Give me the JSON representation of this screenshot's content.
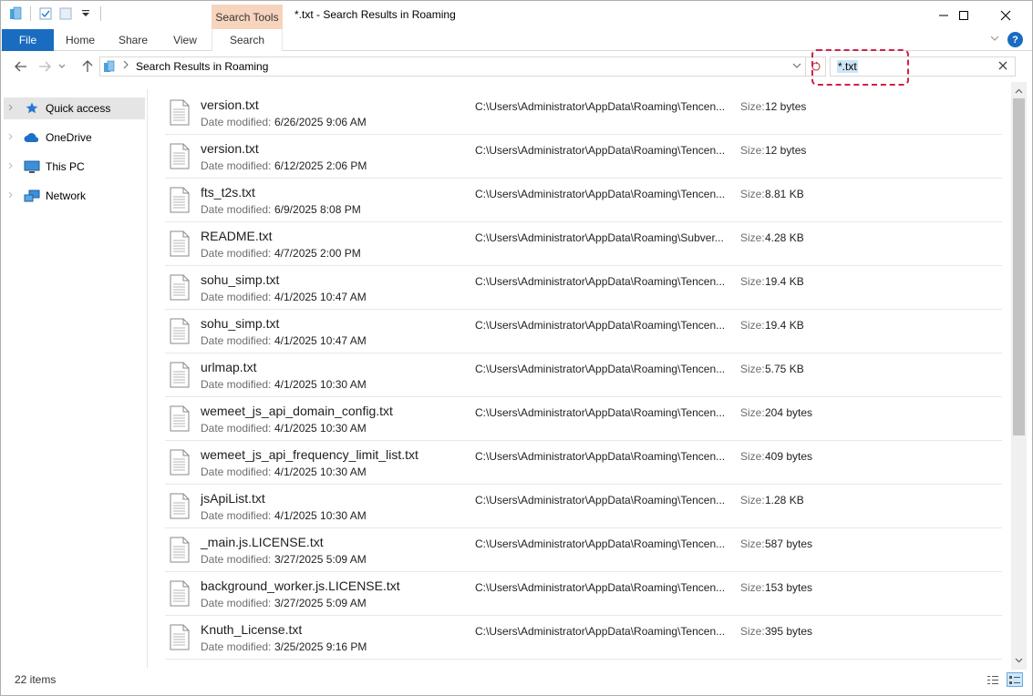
{
  "window": {
    "title": "*.txt - Search Results in Roaming",
    "context_tab": "Search Tools",
    "minimize": "—",
    "maximize": "☐",
    "close": "✕"
  },
  "ribbon": {
    "tabs": [
      "File",
      "Home",
      "Share",
      "View",
      "Search"
    ],
    "help": "?"
  },
  "address": {
    "crumb": "Search Results in Roaming",
    "search_value": "*.txt"
  },
  "nav_pane": {
    "items": [
      {
        "label": "Quick access",
        "icon": "star-icon",
        "selected": true
      },
      {
        "label": "OneDrive",
        "icon": "cloud-icon",
        "selected": false
      },
      {
        "label": "This PC",
        "icon": "computer-icon",
        "selected": false
      },
      {
        "label": "Network",
        "icon": "network-icon",
        "selected": false
      }
    ]
  },
  "results": {
    "date_label": "Date modified:",
    "size_label": "Size:",
    "items": [
      {
        "name": "version.txt",
        "date": "6/26/2025 9:06 AM",
        "path": "C:\\Users\\Administrator\\AppData\\Roaming\\Tencen...",
        "size": "12 bytes"
      },
      {
        "name": "version.txt",
        "date": "6/12/2025 2:06 PM",
        "path": "C:\\Users\\Administrator\\AppData\\Roaming\\Tencen...",
        "size": "12 bytes"
      },
      {
        "name": "fts_t2s.txt",
        "date": "6/9/2025 8:08 PM",
        "path": "C:\\Users\\Administrator\\AppData\\Roaming\\Tencen...",
        "size": "8.81 KB"
      },
      {
        "name": "README.txt",
        "date": "4/7/2025 2:00 PM",
        "path": "C:\\Users\\Administrator\\AppData\\Roaming\\Subver...",
        "size": "4.28 KB"
      },
      {
        "name": "sohu_simp.txt",
        "date": "4/1/2025 10:47 AM",
        "path": "C:\\Users\\Administrator\\AppData\\Roaming\\Tencen...",
        "size": "19.4 KB"
      },
      {
        "name": "sohu_simp.txt",
        "date": "4/1/2025 10:47 AM",
        "path": "C:\\Users\\Administrator\\AppData\\Roaming\\Tencen...",
        "size": "19.4 KB"
      },
      {
        "name": "urlmap.txt",
        "date": "4/1/2025 10:30 AM",
        "path": "C:\\Users\\Administrator\\AppData\\Roaming\\Tencen...",
        "size": "5.75 KB"
      },
      {
        "name": "wemeet_js_api_domain_config.txt",
        "date": "4/1/2025 10:30 AM",
        "path": "C:\\Users\\Administrator\\AppData\\Roaming\\Tencen...",
        "size": "204 bytes"
      },
      {
        "name": "wemeet_js_api_frequency_limit_list.txt",
        "date": "4/1/2025 10:30 AM",
        "path": "C:\\Users\\Administrator\\AppData\\Roaming\\Tencen...",
        "size": "409 bytes"
      },
      {
        "name": "jsApiList.txt",
        "date": "4/1/2025 10:30 AM",
        "path": "C:\\Users\\Administrator\\AppData\\Roaming\\Tencen...",
        "size": "1.28 KB"
      },
      {
        "name": "_main.js.LICENSE.txt",
        "date": "3/27/2025 5:09 AM",
        "path": "C:\\Users\\Administrator\\AppData\\Roaming\\Tencen...",
        "size": "587 bytes"
      },
      {
        "name": "background_worker.js.LICENSE.txt",
        "date": "3/27/2025 5:09 AM",
        "path": "C:\\Users\\Administrator\\AppData\\Roaming\\Tencen...",
        "size": "153 bytes"
      },
      {
        "name": "Knuth_License.txt",
        "date": "3/25/2025 9:16 PM",
        "path": "C:\\Users\\Administrator\\AppData\\Roaming\\Tencen...",
        "size": "395 bytes"
      }
    ]
  },
  "status": {
    "count": "22 items"
  },
  "colors": {
    "accent": "#1a6cc0",
    "context_tab": "#f7d4bd",
    "highlight": "#d21f4a",
    "selection": "#cce4f7"
  }
}
